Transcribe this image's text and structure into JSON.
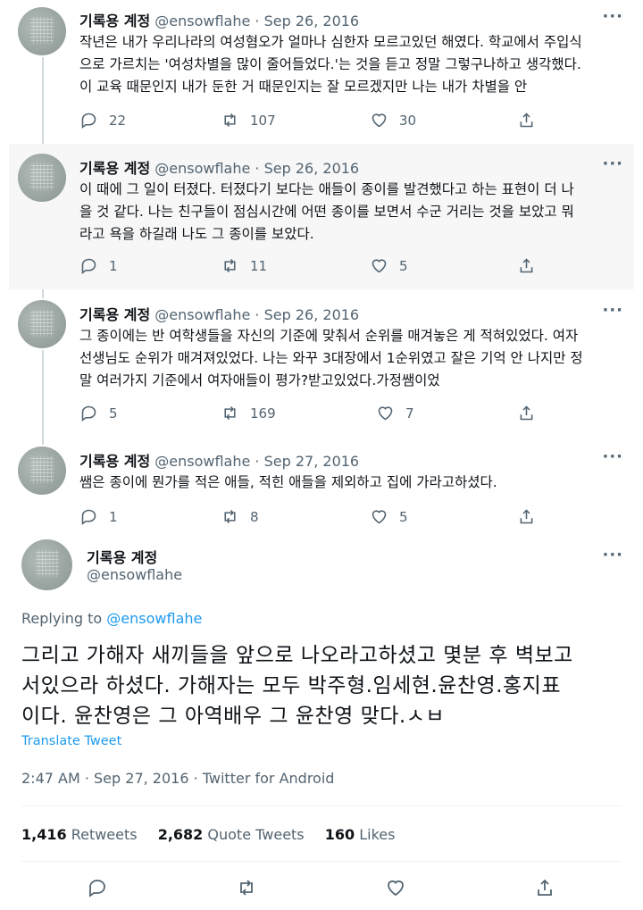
{
  "user": {
    "display_name": "기록용 계정",
    "handle": "@ensowflahe"
  },
  "separator": "·",
  "more_label": "···",
  "tweets": [
    {
      "date": "Sep 26, 2016",
      "lines": [
        "작년은 내가 우리나라의 여성혐오가 얼마나 심한자 모르고있던 해였다. 학교에서 주입식",
        "으로 가르치는 '여성차별을 많이 줄어들었다.'는 것을 듣고 정말 그렇구나하고 생각했다.",
        "이 교육 때문인지 내가 둔한 거 때문인지는 잘 모르겠지만 나는 내가 차별을 안"
      ],
      "replies": "22",
      "retweets": "107",
      "likes": "30"
    },
    {
      "date": "Sep 26, 2016",
      "lines": [
        "이 때에 그 일이 터졌다. 터졌다기 보다는 애들이 종이를 발견했다고 하는 표현이 더 나",
        "을 것 같다. 나는 친구들이 점심시간에 어떤 종이를 보면서 수군 거리는 것을 보았고 뭐",
        "라고 욕을 하길래 나도 그 종이를 보았다."
      ],
      "replies": "1",
      "retweets": "11",
      "likes": "5"
    },
    {
      "date": "Sep 26, 2016",
      "lines": [
        "그 종이에는 반 여학생들을 자신의 기준에 맞춰서 순위를 매겨놓은 게 적혀있었다. 여자",
        "선생님도 순위가 매겨져있었다. 나는 와꾸 3대장에서 1순위였고 잘은 기억 안 나지만 정",
        "말 여러가지 기준에서 여자애들이 평가?받고있었다.가정쌤이었"
      ],
      "replies": "5",
      "retweets": "169",
      "likes": "7"
    },
    {
      "date": "Sep 27, 2016",
      "lines": [
        "쌤은 종이에 뭔가를 적은 애들, 적힌 애들을 제외하고 집에 가라고하셨다."
      ],
      "replies": "1",
      "retweets": "8",
      "likes": "5"
    }
  ],
  "main_tweet": {
    "replying_to_label": "Replying to",
    "replying_to_handle": "@ensowflahe",
    "lines": [
      "그리고 가해자 새끼들을 앞으로 나오라고하셨고 몇분 후 벽보고",
      "서있으라 하셨다. 가해자는 모두 박주형.임세현.윤찬영.홍지표",
      "이다. 윤찬영은 그 아역배우 그 윤찬영 맞다.ㅅㅂ"
    ],
    "translate_label": "Translate Tweet",
    "timestamp": "2:47 AM · Sep 27, 2016 · Twitter for Android",
    "stats": {
      "retweets_count": "1,416",
      "retweets_label": "Retweets",
      "quotes_count": "2,682",
      "quotes_label": "Quote Tweets",
      "likes_count": "160",
      "likes_label": "Likes"
    }
  },
  "colors": {
    "link": "#1d9bf0",
    "secondary_text": "#536471",
    "highlight_bg": "#f7f7f7",
    "thread_line": "#cfd9de"
  },
  "icons": [
    "reply-icon",
    "retweet-icon",
    "like-icon",
    "share-icon",
    "more-icon"
  ]
}
